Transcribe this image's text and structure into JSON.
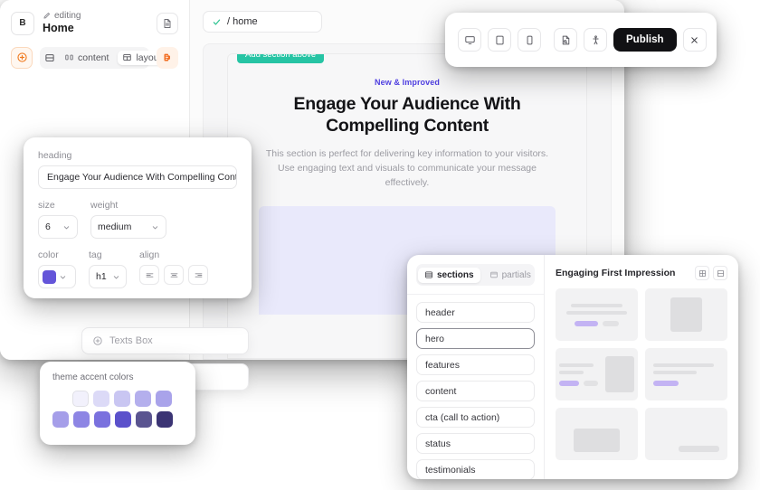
{
  "editor": {
    "brand_initial": "B",
    "editing_label": "editing",
    "page_name": "Home",
    "pencil_icon": "pencil-icon",
    "page_icon": "document-icon",
    "toolbar": {
      "add_icon": "plus-circle-icon",
      "panel_icon": "panel-icon",
      "content_tab": "content",
      "content_icon": "columns-icon",
      "layout_tab": "layout",
      "layout_icon": "layout-grid-icon",
      "extension_icon": "puzzle-orange-icon"
    },
    "url_bar": {
      "status_icon": "check-icon",
      "path": "/ home"
    },
    "canvas": {
      "add_section_badge": "Add section above",
      "eyebrow": "New & Improved",
      "heading_line1": "Engage Your Audience With",
      "heading_line2": "Compelling Content",
      "paragraph": "This section is perfect for delivering key information to your visitors. Use engaging text and visuals to communicate your message effectively.",
      "eyebrow_color": "#4f3fe0",
      "badge_color": "#26c4a4",
      "placeholder_block_color": "#e9e9fb"
    }
  },
  "toolbar": {
    "devices": [
      {
        "name": "desktop-icon"
      },
      {
        "name": "tablet-icon"
      },
      {
        "name": "mobile-icon"
      }
    ],
    "preview_icon": "page-preview-icon",
    "accessibility_icon": "accessibility-icon",
    "publish_label": "Publish",
    "close_icon": "close-icon"
  },
  "heading_panel": {
    "heading_label": "heading",
    "heading_value": "Engage Your Audience With Compelling Cont...",
    "size_label": "size",
    "size_value": "6",
    "weight_label": "weight",
    "weight_value": "medium",
    "color_label": "color",
    "color_value": "#6455d9",
    "tag_label": "tag",
    "tag_value": "h1",
    "align_label": "align",
    "align_options": [
      "align-left-icon",
      "align-center-icon",
      "align-right-icon"
    ]
  },
  "texts_box": {
    "icon": "plus-circle-icon",
    "label": "Texts Box"
  },
  "theme_panel": {
    "title": "theme accent colors",
    "row_top": [
      "#f2f1fc",
      "#dcdaf7",
      "#c9c6f2",
      "#b4afed",
      "#a9a3ea"
    ],
    "row_bottom": [
      "#a59ee9",
      "#8d85e4",
      "#7a71de",
      "#5b51cb",
      "#5a5490",
      "#3b3474"
    ]
  },
  "sections_panel": {
    "tabs": [
      {
        "label": "sections",
        "icon": "sections-icon",
        "active": true
      },
      {
        "label": "partials",
        "icon": "partials-icon",
        "active": false
      }
    ],
    "items": [
      {
        "label": "header",
        "selected": false
      },
      {
        "label": "hero",
        "selected": true
      },
      {
        "label": "features",
        "selected": false
      },
      {
        "label": "content",
        "selected": false
      },
      {
        "label": "cta (call to action)",
        "selected": false
      },
      {
        "label": "status",
        "selected": false
      },
      {
        "label": "testimonials",
        "selected": false
      }
    ],
    "preview_title": "Engaging First Impression",
    "view_toggles": [
      "grid-view-icon",
      "list-view-icon"
    ],
    "accent_color": "#c3b3f3"
  }
}
